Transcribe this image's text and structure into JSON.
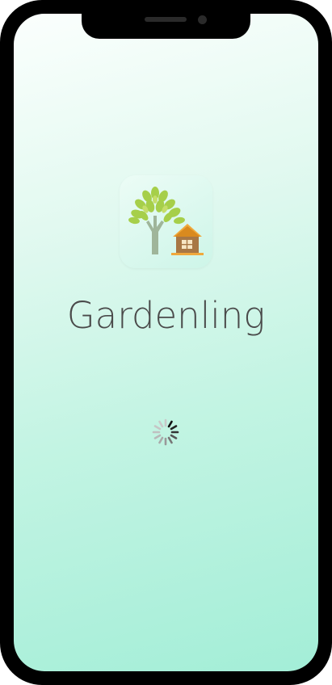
{
  "app": {
    "name": "Gardenling",
    "icon": "tree-and-house-icon"
  },
  "loading": {
    "indicator": "spinner-icon",
    "state": "loading"
  },
  "device": {
    "frame": "phone-frame",
    "notch": "notch"
  },
  "colors": {
    "background_top": "#fbfffd",
    "background_bottom": "#a3eed7",
    "title_text": "#4a4a4a",
    "leaf_green": "#a6cf4a",
    "trunk": "#9fb59a",
    "house_roof": "#f0a93c",
    "house_wall": "#a87744"
  }
}
